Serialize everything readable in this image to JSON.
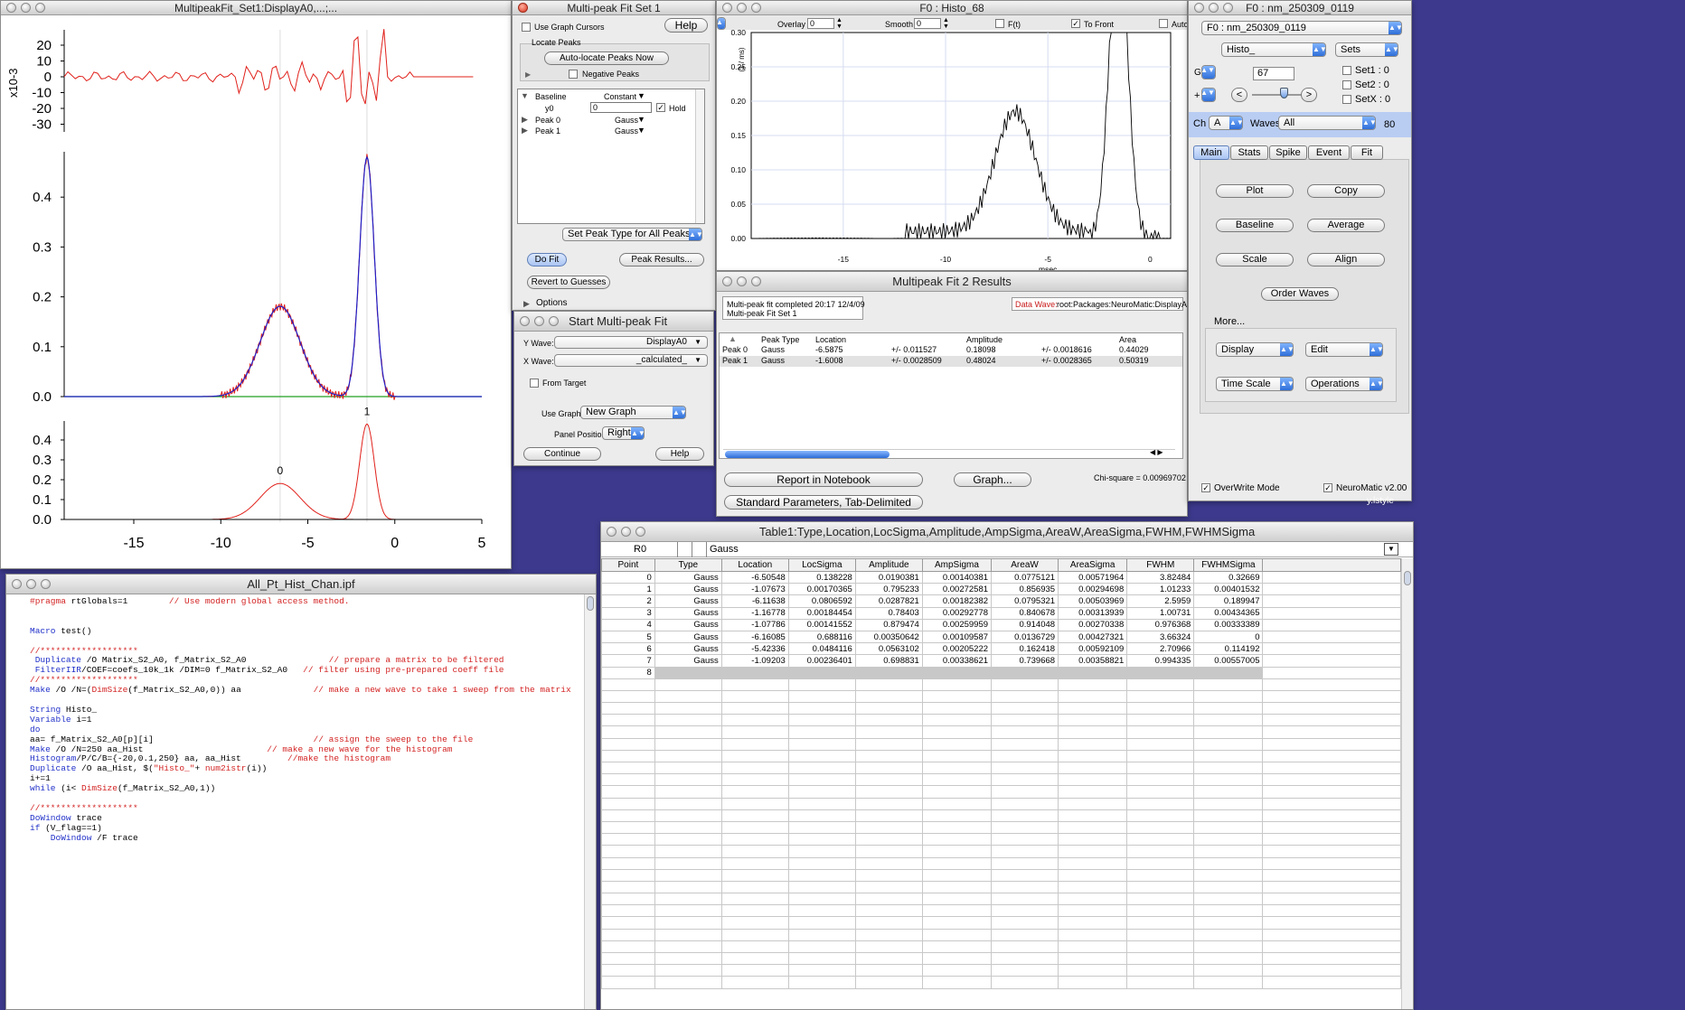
{
  "desktop": {
    "bg": "#3d3a8e",
    "partial_text": "y.lstyle"
  },
  "main_graph": {
    "title": "MultipeakFit_Set1:DisplayA0,...;...",
    "res_ticks": [
      "20",
      "10",
      "0",
      "-10",
      "-20",
      "-30"
    ],
    "res_exp": "x10-3",
    "mid_ticks": [
      "0.4",
      "0.3",
      "0.2",
      "0.1",
      "0.0"
    ],
    "bot_ticks": [
      "0.4",
      "0.3",
      "0.2",
      "0.1",
      "0.0"
    ],
    "x_ticks": [
      "-15",
      "-10",
      "-5",
      "0",
      "5"
    ],
    "peak_labels": [
      "0",
      "1"
    ],
    "trace_color": "#e0201a",
    "fit_color": "#2020c8",
    "baseline_color": "#20a020"
  },
  "mpf_set": {
    "title": "Multi-peak Fit Set 1",
    "use_cursors": "Use Graph Cursors",
    "help": "Help",
    "locate_peaks": "Locate Peaks",
    "auto_locate": "Auto-locate Peaks Now",
    "negative_peaks": "Negative Peaks",
    "rows": [
      {
        "name": "Baseline",
        "type": "Constant"
      },
      {
        "name": "y0",
        "value": "0",
        "hold": "Hold"
      },
      {
        "name": "Peak 0",
        "type": "Gauss"
      },
      {
        "name": "Peak 1",
        "type": "Gauss"
      }
    ],
    "set_peak_type": "Set Peak Type for All Peaks",
    "do_fit": "Do Fit",
    "peak_results": "Peak Results...",
    "revert": "Revert to Guesses",
    "options": "Options"
  },
  "start_mpf": {
    "title": "Start Multi-peak Fit",
    "y_wave_label": "Y Wave:",
    "y_wave": "DisplayA0",
    "x_wave_label": "X Wave:",
    "x_wave": "_calculated_",
    "from_target": "From Target",
    "use_graph_label": "Use Graph:",
    "use_graph": "New Graph",
    "panel_pos_label": "Panel Position",
    "panel_pos": "Right",
    "continue": "Continue",
    "help": "Help"
  },
  "histo": {
    "title": "F0 : Histo_68",
    "overlay_label": "Overlay",
    "overlay_val": "0",
    "smooth_label": "Smooth",
    "smooth_val": "0",
    "ft_label": "F(t)",
    "to_front": "To Front",
    "auto": "Auto",
    "y_ticks": [
      "0.30",
      "0.25",
      "0.20",
      "0.15",
      "0.10",
      "0.05",
      "0.00"
    ],
    "x_ticks": [
      "-15",
      "-10",
      "-5",
      "0"
    ],
    "x_label": "msec",
    "y_label": "(1 / ms)"
  },
  "results": {
    "title": "Multipeak Fit 2 Results",
    "msg1": "Multi-peak fit completed 20:17 12/4/09",
    "msg2": "Multi-peak Fit Set 1",
    "data_wave_label": "Data Wave:",
    "data_wave": "root:Packages:NeuroMatic:DisplayA0",
    "headers": [
      "Peak Type",
      "Location",
      "Amplitude",
      "Area"
    ],
    "rows": [
      {
        "name": "Peak 0",
        "type": "Gauss",
        "loc": "-6.5875",
        "loc_err": "+/- 0.011527",
        "amp": "0.18098",
        "amp_err": "+/- 0.0018616",
        "area": "0.44029"
      },
      {
        "name": "Peak 1",
        "type": "Gauss",
        "loc": "-1.6008",
        "loc_err": "+/- 0.0028509",
        "amp": "0.48024",
        "amp_err": "+/- 0.0028365",
        "area": "0.50319"
      }
    ],
    "report": "Report in Notebook",
    "graph": "Graph...",
    "standard": "Standard Parameters, Tab-Delimited",
    "chisq": "Chi-square = 0.00969702"
  },
  "nm": {
    "title": "F0 : nm_250309_0119",
    "folder": "F0 : nm_250309_0119",
    "prefix": "Histo_",
    "sets": "Sets",
    "count": "67",
    "set1": "Set1 : 0",
    "set2": "Set2 : 0",
    "setx": "SetX : 0",
    "ch_label": "Ch",
    "ch": "A",
    "waves_label": "Waves",
    "waves": "All",
    "waves_count": "80",
    "tabs": [
      "Main",
      "Stats",
      "Spike",
      "Event",
      "Fit"
    ],
    "buttons": [
      "Plot",
      "Copy",
      "Baseline",
      "Average",
      "Scale",
      "Align",
      "Order Waves"
    ],
    "more": "More...",
    "menus": [
      "Display",
      "Edit",
      "Time Scale",
      "Operations"
    ],
    "overwrite": "OverWrite Mode",
    "version": "NeuroMatic v2.00"
  },
  "procedure": {
    "title": "All_Pt_Hist_Chan.ipf",
    "lines": [
      [
        {
          "t": "#pragma ",
          "k": "c"
        },
        {
          "t": "rtGlobals=1",
          "k": ""
        },
        {
          "t": "        // Use modern global access method.",
          "k": "c"
        }
      ],
      [],
      [],
      [
        {
          "t": "Macro ",
          "k": "k"
        },
        {
          "t": "test()",
          "k": ""
        }
      ],
      [],
      [
        {
          "t": "//*******************",
          "k": "c"
        }
      ],
      [
        {
          "t": " Duplicate ",
          "k": "k"
        },
        {
          "t": "/O Matrix_S2_A0, f_Matrix_S2_A0",
          "k": ""
        },
        {
          "t": "                // prepare a matrix to be filtered",
          "k": "c"
        }
      ],
      [
        {
          "t": " FilterIIR",
          "k": "k"
        },
        {
          "t": "/COEF=coefs_10k_1k /DIM=0 f_Matrix_S2_A0",
          "k": ""
        },
        {
          "t": "   // filter using pre-prepared coeff file",
          "k": "c"
        }
      ],
      [
        {
          "t": "//*******************",
          "k": "c"
        }
      ],
      [
        {
          "t": "Make ",
          "k": "k"
        },
        {
          "t": "/O /N=(",
          "k": ""
        },
        {
          "t": "DimSize",
          "k": "c"
        },
        {
          "t": "(f_Matrix_S2_A0,0)) aa",
          "k": ""
        },
        {
          "t": "              // make a new wave to take 1 sweep from the matrix",
          "k": "c"
        }
      ],
      [],
      [
        {
          "t": "String ",
          "k": "k"
        },
        {
          "t": "Histo_",
          "k": ""
        }
      ],
      [
        {
          "t": "Variable ",
          "k": "k"
        },
        {
          "t": "i=1",
          "k": ""
        }
      ],
      [
        {
          "t": "do",
          "k": "k"
        }
      ],
      [
        {
          "t": "aa= f_Matrix_S2_A0[p][i]",
          "k": ""
        },
        {
          "t": "                               // assign the sweep to the file",
          "k": "c"
        }
      ],
      [
        {
          "t": "Make ",
          "k": "k"
        },
        {
          "t": "/O /N=250 aa_Hist",
          "k": ""
        },
        {
          "t": "                        // make a new wave for the histogram",
          "k": "c"
        }
      ],
      [
        {
          "t": "Histogram",
          "k": "k"
        },
        {
          "t": "/P/C/B={-20,0.1,250} aa, aa_Hist",
          "k": ""
        },
        {
          "t": "         //make the histogram",
          "k": "c"
        }
      ],
      [
        {
          "t": "Duplicate ",
          "k": "k"
        },
        {
          "t": "/O aa_Hist, $(",
          "k": ""
        },
        {
          "t": "\"Histo_\"",
          "k": "c"
        },
        {
          "t": "+ ",
          "k": ""
        },
        {
          "t": "num2istr",
          "k": "c"
        },
        {
          "t": "(i))",
          "k": ""
        }
      ],
      [
        {
          "t": "i+=1",
          "k": ""
        }
      ],
      [
        {
          "t": "while ",
          "k": "k"
        },
        {
          "t": "(i< ",
          "k": ""
        },
        {
          "t": "DimSize",
          "k": "c"
        },
        {
          "t": "(f_Matrix_S2_A0,1))",
          "k": ""
        }
      ],
      [],
      [
        {
          "t": "//*******************",
          "k": "c"
        }
      ],
      [
        {
          "t": "DoWindow ",
          "k": "k"
        },
        {
          "t": "trace",
          "k": ""
        }
      ],
      [
        {
          "t": "if ",
          "k": "k"
        },
        {
          "t": "(V_flag==1)",
          "k": ""
        }
      ],
      [
        {
          "t": "    DoWindow ",
          "k": "k"
        },
        {
          "t": "/F trace",
          "k": ""
        }
      ]
    ]
  },
  "table": {
    "title": "Table1:Type,Location,LocSigma,Amplitude,AmpSigma,AreaW,AreaSigma,FWHM,FWHMSigma",
    "cell_ref": "R0",
    "cell_val": "Gauss",
    "headers": [
      "Point",
      "Type",
      "Location",
      "LocSigma",
      "Amplitude",
      "AmpSigma",
      "AreaW",
      "AreaSigma",
      "FWHM",
      "FWHMSigma"
    ],
    "rows": [
      [
        "0",
        "Gauss",
        "-6.50548",
        "0.138228",
        "0.0190381",
        "0.00140381",
        "0.0775121",
        "0.00571964",
        "3.82484",
        "0.32669"
      ],
      [
        "1",
        "Gauss",
        "-1.07673",
        "0.00170365",
        "0.795233",
        "0.00272581",
        "0.856935",
        "0.00294698",
        "1.01233",
        "0.00401532"
      ],
      [
        "2",
        "Gauss",
        "-6.11638",
        "0.0806592",
        "0.0287821",
        "0.00182382",
        "0.0795321",
        "0.00503969",
        "2.5959",
        "0.189947"
      ],
      [
        "3",
        "Gauss",
        "-1.16778",
        "0.00184454",
        "0.78403",
        "0.00292778",
        "0.840678",
        "0.00313939",
        "1.00731",
        "0.00434365"
      ],
      [
        "4",
        "Gauss",
        "-1.07786",
        "0.00141552",
        "0.879474",
        "0.00259959",
        "0.914048",
        "0.00270338",
        "0.976368",
        "0.00333389"
      ],
      [
        "5",
        "Gauss",
        "-6.16085",
        "0.688116",
        "0.00350642",
        "0.00109587",
        "0.0136729",
        "0.00427321",
        "3.66324",
        "0"
      ],
      [
        "6",
        "Gauss",
        "-5.42336",
        "0.0484116",
        "0.0563102",
        "0.00205222",
        "0.162418",
        "0.00592109",
        "2.70966",
        "0.114192"
      ],
      [
        "7",
        "Gauss",
        "-1.09203",
        "0.00236401",
        "0.698831",
        "0.00338621",
        "0.739668",
        "0.00358821",
        "0.994335",
        "0.00557005"
      ],
      [
        "8",
        "",
        "",
        "",
        "",
        "",
        "",
        "",
        "",
        ""
      ]
    ]
  }
}
